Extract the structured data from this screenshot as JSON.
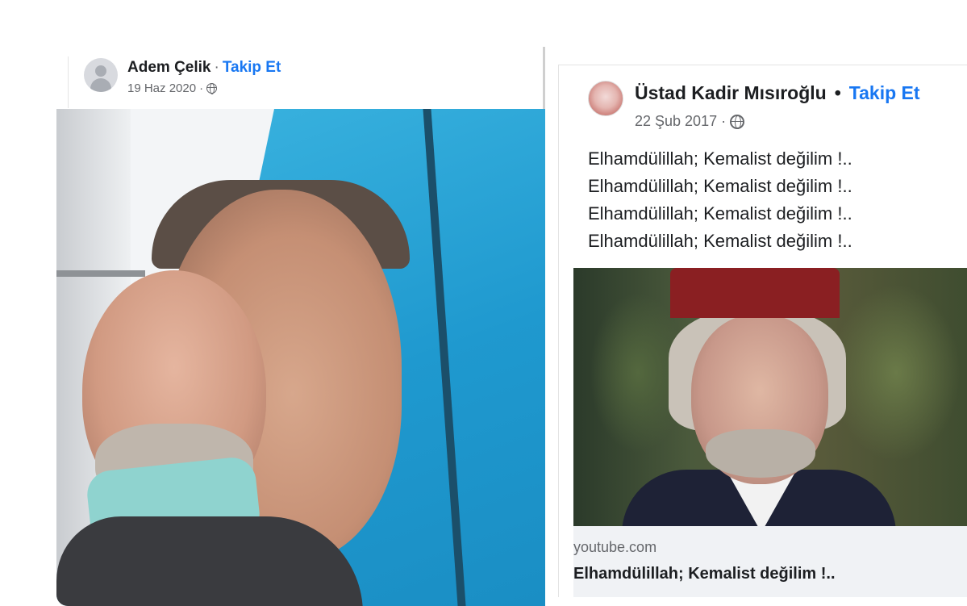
{
  "left_post": {
    "author": "Adem Çelik",
    "separator": "·",
    "follow_label": "Takip Et",
    "date": "19 Haz 2020",
    "date_separator": "·",
    "privacy_icon": "globe-icon"
  },
  "right_post": {
    "author": "Üstad Kadir Mısıroğlu",
    "separator": "•",
    "follow_label": "Takip Et",
    "date": "22 Şub 2017",
    "date_separator": "·",
    "privacy_icon": "globe-icon",
    "text_lines": [
      "Elhamdülillah; Kemalist değilim !..",
      "Elhamdülillah; Kemalist değilim !..",
      "Elhamdülillah; Kemalist değilim !..",
      "Elhamdülillah; Kemalist değilim !.."
    ],
    "link": {
      "domain": "youtube.com",
      "title": "Elhamdülillah; Kemalist değilim !.."
    }
  },
  "colors": {
    "follow_blue": "#1877f2",
    "meta_gray": "#65676b",
    "link_card_bg": "#f0f2f5"
  }
}
